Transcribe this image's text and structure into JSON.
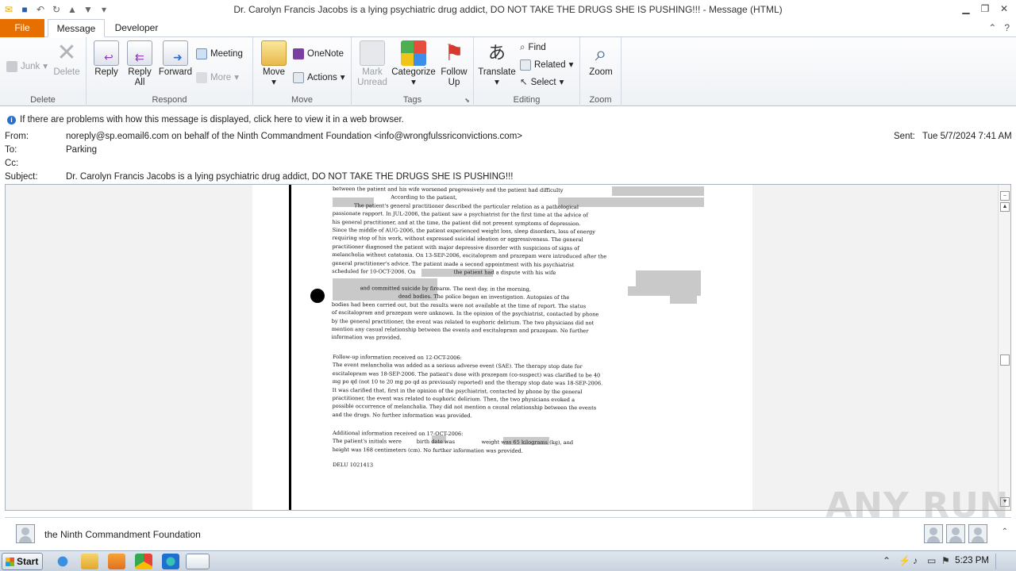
{
  "window": {
    "title": "Dr. Carolyn Francis Jacobs is a lying psychiatric drug addict, DO NOT TAKE THE DRUGS SHE IS PUSHING!!! - Message (HTML)"
  },
  "tabs": {
    "file": "File",
    "message": "Message",
    "developer": "Developer"
  },
  "ribbon": {
    "delete_group": {
      "label": "Delete",
      "junk": "Junk",
      "delete": "Delete"
    },
    "respond_group": {
      "label": "Respond",
      "reply": "Reply",
      "reply_all": "Reply All",
      "forward": "Forward",
      "meeting": "Meeting",
      "more": "More"
    },
    "move_group": {
      "label": "Move",
      "move": "Move",
      "onenote": "OneNote",
      "actions": "Actions"
    },
    "tags_group": {
      "label": "Tags",
      "mark_unread": "Mark Unread",
      "categorize": "Categorize",
      "follow_up": "Follow Up"
    },
    "editing_group": {
      "label": "Editing",
      "translate": "Translate",
      "find": "Find",
      "related": "Related",
      "select": "Select"
    },
    "zoom_group": {
      "label": "Zoom",
      "zoom": "Zoom"
    }
  },
  "infobar": {
    "text": "If there are problems with how this message is displayed, click here to view it in a web browser."
  },
  "header": {
    "from_label": "From:",
    "from_value": "noreply@sp.eomail6.com on behalf of the Ninth Commandment Foundation <info@wrongfulssriconvictions.com>",
    "to_label": "To:",
    "to_value": "Parking",
    "cc_label": "Cc:",
    "subject_label": "Subject:",
    "subject_value": "Dr. Carolyn Francis Jacobs is a lying psychiatric drug addict, DO NOT TAKE THE DRUGS SHE IS PUSHING!!!",
    "sent_label": "Sent:",
    "sent_value": "Tue 5/7/2024 7:41 AM"
  },
  "document": {
    "lines_a": [
      "between the patient and his wife worsened progressively and the patient had difficulty",
      "                                   According to the patient,",
      "             The patient's general practitioner described the particular relation as a pathological",
      "passionate rapport. In JUL-2006, the patient saw a psychiatrist for the first time at the advice of",
      "his general practitioner, and at the time, the patient did not present symptoms of depression.",
      "Since the middle of AUG-2006, the patient experienced weight loss, sleep disorders, loss of energy",
      "requiring stop of his work, without expressed suicidal ideation or aggressiveness. The general",
      "practitioner diagnosed the patient with major depressive disorder with suspicions of signs of",
      "melancholia without catatonia. On 13-SEP-2006, escitalopram and prazepam were introduced after the",
      "general practitioner's advice. The patient made a second appointment with his psychiatrist",
      "scheduled for 10-OCT-2006. On                       the patient had a dispute with his wife",
      "",
      "                 and committed suicide by firearm. The next day, in the morning,",
      "                                        dead bodies. The police began an investigation. Autopsies of the",
      "bodies had been carried out, but the results were not available at the time of report. The status",
      "of escitalopram and prazepam were unknown. In the opinion of the psychiatrist, contacted by phone",
      "by the general practitioner, the event was related to euphoric delirium. The two physicians did not",
      "mention any casual relationship between the events and escitalopram and prazepam. No further",
      "information was provided."
    ],
    "lines_b": [
      "Follow-up information received on 12-OCT-2006:",
      "The event melancholia was added as a serious adverse event (SAE). The therapy stop date for",
      "escitalopram was 18-SEP-2006. The patient's dose with prazepam (co-suspect) was clarified to be 40",
      "mg po qd (not 10 to 20 mg po qd as previously reported) and the therapy stop date was 18-SEP-2006.",
      "It was clarified that, first in the opinion of the psychiatrist, contacted by phone by the general",
      "practitioner, the event was related to euphoric delirium. Then, the two physicians evoked a",
      "possible occurrence of melancholia. They did not mention a causal relationship between the events",
      "and the drugs. No further information was provided."
    ],
    "lines_c": [
      "Additional information received on 17-OCT-2006:",
      "The patient's initials were         birth date was                weight was 65 kilograms (kg), and",
      "height was 168 centimeters (cm). No further information was provided."
    ],
    "ref": "DELU 1021413"
  },
  "people_pane": {
    "name": "the Ninth Commandment Foundation"
  },
  "watermark": "ANY RUN",
  "taskbar": {
    "start": "Start",
    "clock": "5:23 PM"
  }
}
